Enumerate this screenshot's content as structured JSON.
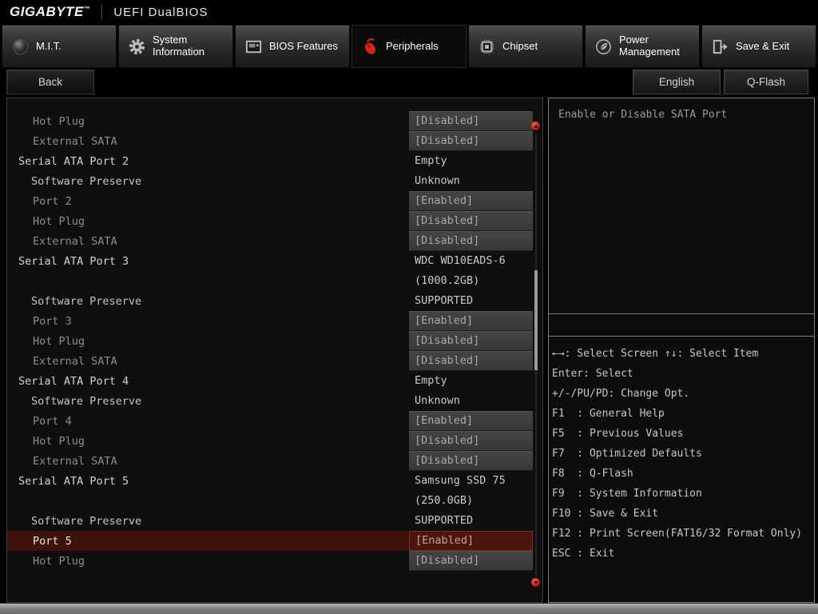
{
  "header": {
    "brand": "GIGABYTE",
    "trademark": "™",
    "title": "UEFI DualBIOS"
  },
  "tabs": [
    {
      "label": "M.I.T.",
      "icon": "mit-icon",
      "active": false
    },
    {
      "label": "System Information",
      "icon": "system-information-icon",
      "active": false
    },
    {
      "label": "BIOS Features",
      "icon": "bios-features-icon",
      "active": false
    },
    {
      "label": "Peripherals",
      "icon": "peripherals-icon",
      "active": true
    },
    {
      "label": "Chipset",
      "icon": "chipset-icon",
      "active": false
    },
    {
      "label": "Power Management",
      "icon": "power-management-icon",
      "active": false
    },
    {
      "label": "Save & Exit",
      "icon": "save-exit-icon",
      "active": false
    }
  ],
  "toolbar": {
    "back_label": "Back",
    "language_label": "English",
    "qflash_label": "Q-Flash"
  },
  "settings": {
    "rows": [
      {
        "label": "Hot Plug",
        "value": "[Disabled]",
        "style": "sub",
        "boxed": true,
        "selected": false
      },
      {
        "label": "External SATA",
        "value": "[Disabled]",
        "style": "sub",
        "boxed": true,
        "selected": false
      },
      {
        "label": "Serial ATA Port 2",
        "value": "Empty",
        "style": "header",
        "boxed": false,
        "selected": false
      },
      {
        "label": "Software Preserve",
        "value": "Unknown",
        "style": "subheader",
        "boxed": false,
        "selected": false
      },
      {
        "label": "Port 2",
        "value": "[Enabled]",
        "style": "sub",
        "boxed": true,
        "selected": false
      },
      {
        "label": "Hot Plug",
        "value": "[Disabled]",
        "style": "sub",
        "boxed": true,
        "selected": false
      },
      {
        "label": "External SATA",
        "value": "[Disabled]",
        "style": "sub",
        "boxed": true,
        "selected": false
      },
      {
        "label": "Serial ATA Port 3",
        "value": "WDC WD10EADS-6",
        "style": "header",
        "boxed": false,
        "selected": false
      },
      {
        "label": "",
        "value": "(1000.2GB)",
        "style": "cont",
        "boxed": false,
        "selected": false
      },
      {
        "label": "Software Preserve",
        "value": "SUPPORTED",
        "style": "subheader",
        "boxed": false,
        "selected": false
      },
      {
        "label": "Port 3",
        "value": "[Enabled]",
        "style": "sub",
        "boxed": true,
        "selected": false
      },
      {
        "label": "Hot Plug",
        "value": "[Disabled]",
        "style": "sub",
        "boxed": true,
        "selected": false
      },
      {
        "label": "External SATA",
        "value": "[Disabled]",
        "style": "sub",
        "boxed": true,
        "selected": false
      },
      {
        "label": "Serial ATA Port 4",
        "value": "Empty",
        "style": "header",
        "boxed": false,
        "selected": false
      },
      {
        "label": "Software Preserve",
        "value": "Unknown",
        "style": "subheader",
        "boxed": false,
        "selected": false
      },
      {
        "label": "Port 4",
        "value": "[Enabled]",
        "style": "sub",
        "boxed": true,
        "selected": false
      },
      {
        "label": "Hot Plug",
        "value": "[Disabled]",
        "style": "sub",
        "boxed": true,
        "selected": false
      },
      {
        "label": "External SATA",
        "value": "[Disabled]",
        "style": "sub",
        "boxed": true,
        "selected": false
      },
      {
        "label": "Serial ATA Port 5",
        "value": "Samsung SSD 75",
        "style": "header",
        "boxed": false,
        "selected": false
      },
      {
        "label": "",
        "value": "(250.0GB)",
        "style": "cont",
        "boxed": false,
        "selected": false
      },
      {
        "label": "Software Preserve",
        "value": "SUPPORTED",
        "style": "subheader",
        "boxed": false,
        "selected": false
      },
      {
        "label": "Port 5",
        "value": "[Enabled]",
        "style": "sub",
        "boxed": true,
        "selected": true
      },
      {
        "label": "Hot Plug",
        "value": "[Disabled]",
        "style": "sub",
        "boxed": true,
        "selected": false
      }
    ]
  },
  "help": {
    "description": "Enable or Disable SATA Port",
    "keys": [
      "←→: Select Screen ↑↓: Select Item",
      "Enter: Select",
      "+/-/PU/PD: Change Opt.",
      "F1  : General Help",
      "F5  : Previous Values",
      "F7  : Optimized Defaults",
      "F8  : Q-Flash",
      "F9  : System Information",
      "F10 : Save & Exit",
      "F12 : Print Screen(FAT16/32 Format Only)",
      "ESC : Exit"
    ]
  },
  "colors": {
    "accent_red": "#d2261a",
    "selected_row": "#3f120c",
    "value_box": "#3c3c3c"
  }
}
